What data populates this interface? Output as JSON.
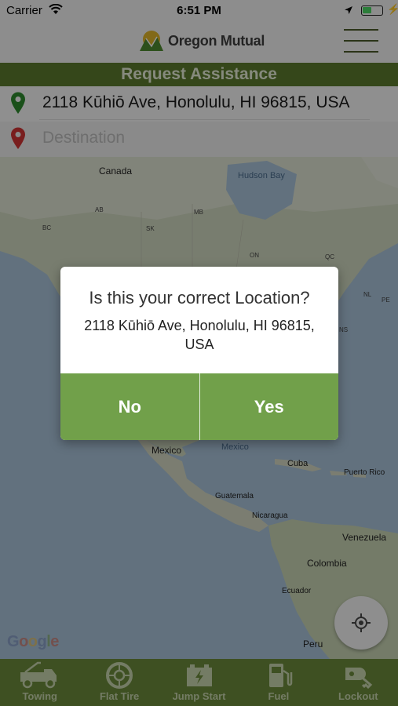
{
  "status_bar": {
    "carrier": "Carrier",
    "time": "6:51 PM",
    "battery_level": 0.45
  },
  "header": {
    "brand_name": "Oregon Mutual",
    "menu_icon": "hamburger-menu-icon"
  },
  "request_bar": {
    "title": "Request Assistance"
  },
  "locations": {
    "origin": {
      "value": "2118 Kūhiō Ave, Honolulu, HI 96815, USA",
      "icon": "green-pin-icon",
      "pin_color": "#2e8b2e"
    },
    "destination": {
      "placeholder": "Destination",
      "icon": "red-pin-icon",
      "pin_color": "#d03434"
    }
  },
  "map": {
    "labels": {
      "canada": "Canada",
      "hudson_bay": "Hudson Bay",
      "ab": "AB",
      "bc": "BC",
      "sk": "SK",
      "mb": "MB",
      "on": "ON",
      "qc": "QC",
      "nl": "NL",
      "pe": "PE",
      "ns": "NS",
      "mexico": "Mexico",
      "gulf": "Mexico",
      "cuba": "Cuba",
      "puerto_rico": "Puerto Rico",
      "guatemala": "Guatemala",
      "nicaragua": "Nicaragua",
      "venezuela": "Venezuela",
      "colombia": "Colombia",
      "ecuador": "Ecuador",
      "peru": "Peru"
    },
    "attribution": [
      "G",
      "o",
      "o",
      "g",
      "l",
      "e"
    ],
    "locate_icon": "crosshair-locate-icon"
  },
  "dialog": {
    "title": "Is this your correct Location?",
    "message": "2118 Kūhiō Ave, Honolulu, HI 96815, USA",
    "no_label": "No",
    "yes_label": "Yes",
    "button_color": "#71a04a"
  },
  "tabs": [
    {
      "label": "Towing",
      "icon": "tow-truck-icon"
    },
    {
      "label": "Flat Tire",
      "icon": "tire-icon"
    },
    {
      "label": "Jump Start",
      "icon": "battery-icon"
    },
    {
      "label": "Fuel",
      "icon": "fuel-pump-icon"
    },
    {
      "label": "Lockout",
      "icon": "car-key-icon"
    }
  ],
  "colors": {
    "brand_green": "#5c7a2e",
    "tab_bar": "#6b8a3b"
  }
}
